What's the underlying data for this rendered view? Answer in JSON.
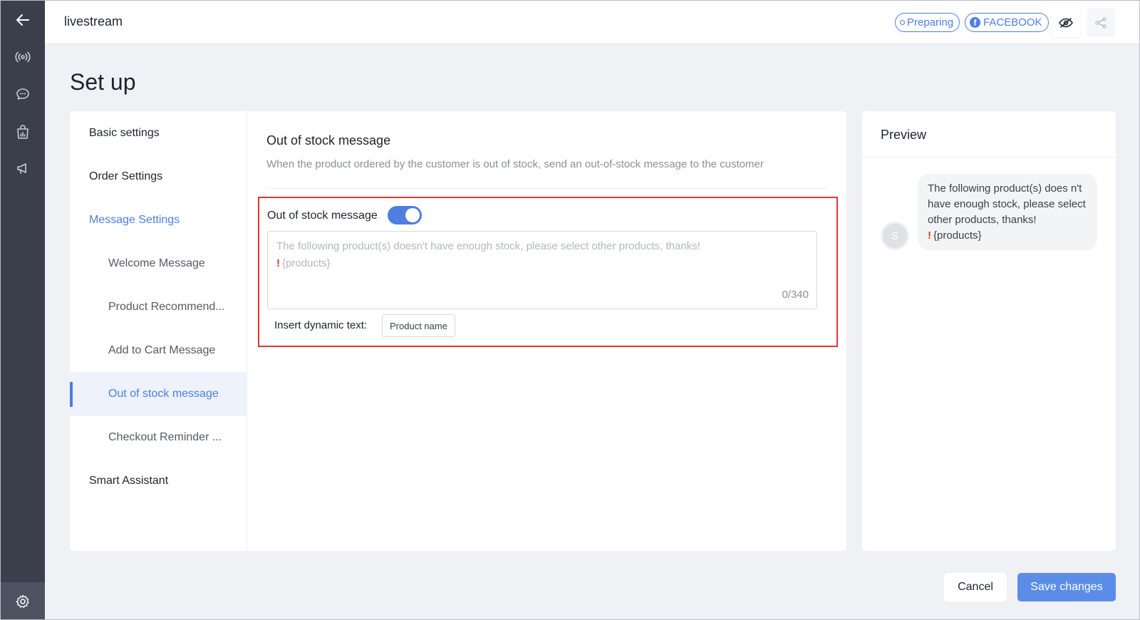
{
  "header": {
    "title": "livestream",
    "status_pill": "Preparing",
    "platform_pill": "FACEBOOK",
    "platform_icon_letter": "f"
  },
  "page": {
    "title": "Set up"
  },
  "sidebar": {
    "items": [
      {
        "label": "Basic settings",
        "level": 1
      },
      {
        "label": "Order Settings",
        "level": 1
      },
      {
        "label": "Message Settings",
        "level": 1
      },
      {
        "label": "Welcome Message",
        "level": 2
      },
      {
        "label": "Product Recommend...",
        "level": 2
      },
      {
        "label": "Add to Cart Message",
        "level": 2
      },
      {
        "label": "Out of stock message",
        "level": 2,
        "active": true
      },
      {
        "label": "Checkout Reminder ...",
        "level": 2
      },
      {
        "label": "Smart Assistant",
        "level": 1
      }
    ]
  },
  "section": {
    "title": "Out of stock message",
    "description": "When the product ordered by the customer is out of stock, send an out-of-stock message to the customer",
    "toggle_label": "Out of stock message",
    "toggle_on": true,
    "textarea_placeholder_line1": "The following product(s) doesn't have enough stock, please select other products, thanks!",
    "textarea_placeholder_excl": "!",
    "textarea_placeholder_line2": "{products}",
    "counter": "0/340",
    "insert_label": "Insert dynamic text:",
    "insert_tag": "Product name"
  },
  "preview": {
    "title": "Preview",
    "avatar_letter": "S",
    "bubble_text": "The following product(s) does n't have enough stock, please select other products, thanks!",
    "bubble_excl": "!",
    "bubble_var": "{products}"
  },
  "footer": {
    "cancel": "Cancel",
    "save": "Save changes"
  },
  "colors": {
    "accent": "#4d7ee0",
    "rail": "#3a3f4b",
    "highlight_border": "#e0382e"
  }
}
